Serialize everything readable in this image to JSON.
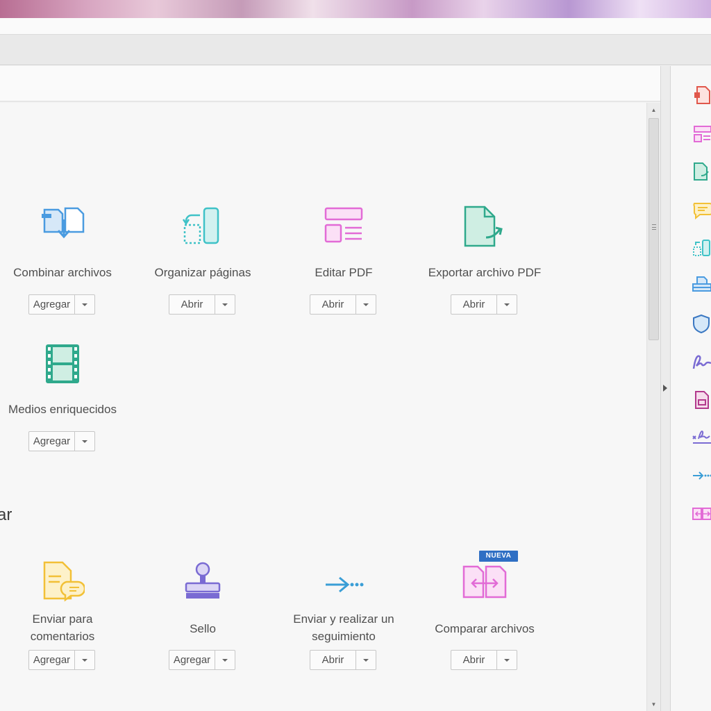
{
  "tools_create": [
    {
      "label": "Combinar archivos",
      "button": "Agregar"
    },
    {
      "label": "Organizar páginas",
      "button": "Abrir"
    },
    {
      "label": "Editar PDF",
      "button": "Abrir"
    },
    {
      "label": "Exportar archivo PDF",
      "button": "Abrir"
    },
    {
      "label": "Medios enriquecidos",
      "button": "Agregar"
    }
  ],
  "section2_heading": "ar",
  "tools_share": [
    {
      "label_line1": "Enviar para",
      "label_line2": "comentarios",
      "button": "Agregar"
    },
    {
      "label": "Sello",
      "button": "Agregar"
    },
    {
      "label_line1": "Enviar y realizar un",
      "label_line2": "seguimiento",
      "button": "Abrir"
    },
    {
      "label": "Comparar archivos",
      "button": "Abrir",
      "badge": "NUEVA"
    }
  ],
  "icons": {
    "combine": "combine-files-icon",
    "organize": "organize-pages-icon",
    "edit": "edit-pdf-icon",
    "export": "export-pdf-icon",
    "rich_media": "film-icon",
    "send_comments": "send-for-comments-icon",
    "stamp": "stamp-icon",
    "send_track": "send-track-icon",
    "compare": "compare-files-icon"
  },
  "colors": {
    "blue": "#4a9be0",
    "teal": "#2fa98c",
    "pink": "#e26bd6",
    "yellow": "#f2c036",
    "purple": "#7a6bd3",
    "badge": "#2f6fc4"
  }
}
